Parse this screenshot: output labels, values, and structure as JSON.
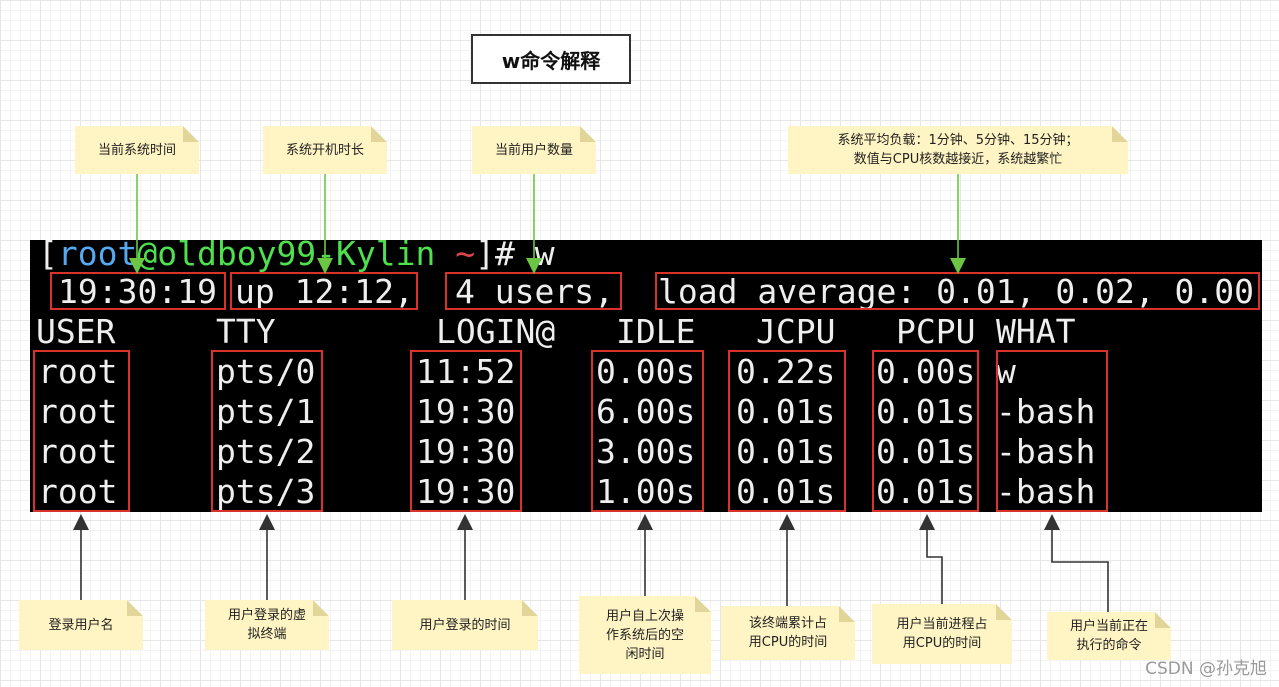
{
  "title": "w命令解释",
  "terminal": {
    "prompt": {
      "open_bracket": "[",
      "user": "root",
      "at": "@",
      "host": "oldboy99-Kylin",
      "tilde": "~",
      "close_bracket": "]# ",
      "command": "w"
    },
    "uptime_line": {
      "time": "19:30:19",
      "uptime": "up 12:12,",
      "users": "4 users,",
      "load": "load average: 0.01, 0.02, 0.00"
    },
    "columns": [
      "USER",
      "TTY",
      "LOGIN@",
      "IDLE",
      "JCPU",
      "PCPU",
      "WHAT"
    ],
    "rows": [
      [
        "root",
        "pts/0",
        "11:52",
        "0.00s",
        "0.22s",
        "0.00s",
        "w"
      ],
      [
        "root",
        "pts/1",
        "19:30",
        "6.00s",
        "0.01s",
        "0.01s",
        "-bash"
      ],
      [
        "root",
        "pts/2",
        "19:30",
        "3.00s",
        "0.01s",
        "0.01s",
        "-bash"
      ],
      [
        "root",
        "pts/3",
        "19:30",
        "1.00s",
        "0.01s",
        "0.01s",
        "-bash"
      ]
    ]
  },
  "notes_top": {
    "current_time": "当前系统时间",
    "uptime": "系统开机时长",
    "users": "当前用户数量",
    "load_line1": "系统平均负载：1分钟、5分钟、15分钟；",
    "load_line2": "数值与CPU核数越接近，系统越繁忙"
  },
  "notes_bottom": {
    "user": "登录用户名",
    "tty_line1": "用户登录的虚",
    "tty_line2": "拟终端",
    "login": "用户登录的时间",
    "idle_line1": "用户自上次操",
    "idle_line2": "作系统后的空",
    "idle_line3": "闲时间",
    "jcpu_line1": "该终端累计占",
    "jcpu_line2": "用CPU的时间",
    "pcpu_line1": "用户当前进程占",
    "pcpu_line2": "用CPU的时间",
    "what_line1": "用户当前正在",
    "what_line2": "执行的命令"
  },
  "watermark": "CSDN @孙克旭",
  "colors": {
    "terminal_bg": "#000000",
    "highlight_box": "#d9322a",
    "arrow_green": "#6cc644",
    "arrow_dark": "#333333",
    "note_bg": "#fff4c3"
  }
}
